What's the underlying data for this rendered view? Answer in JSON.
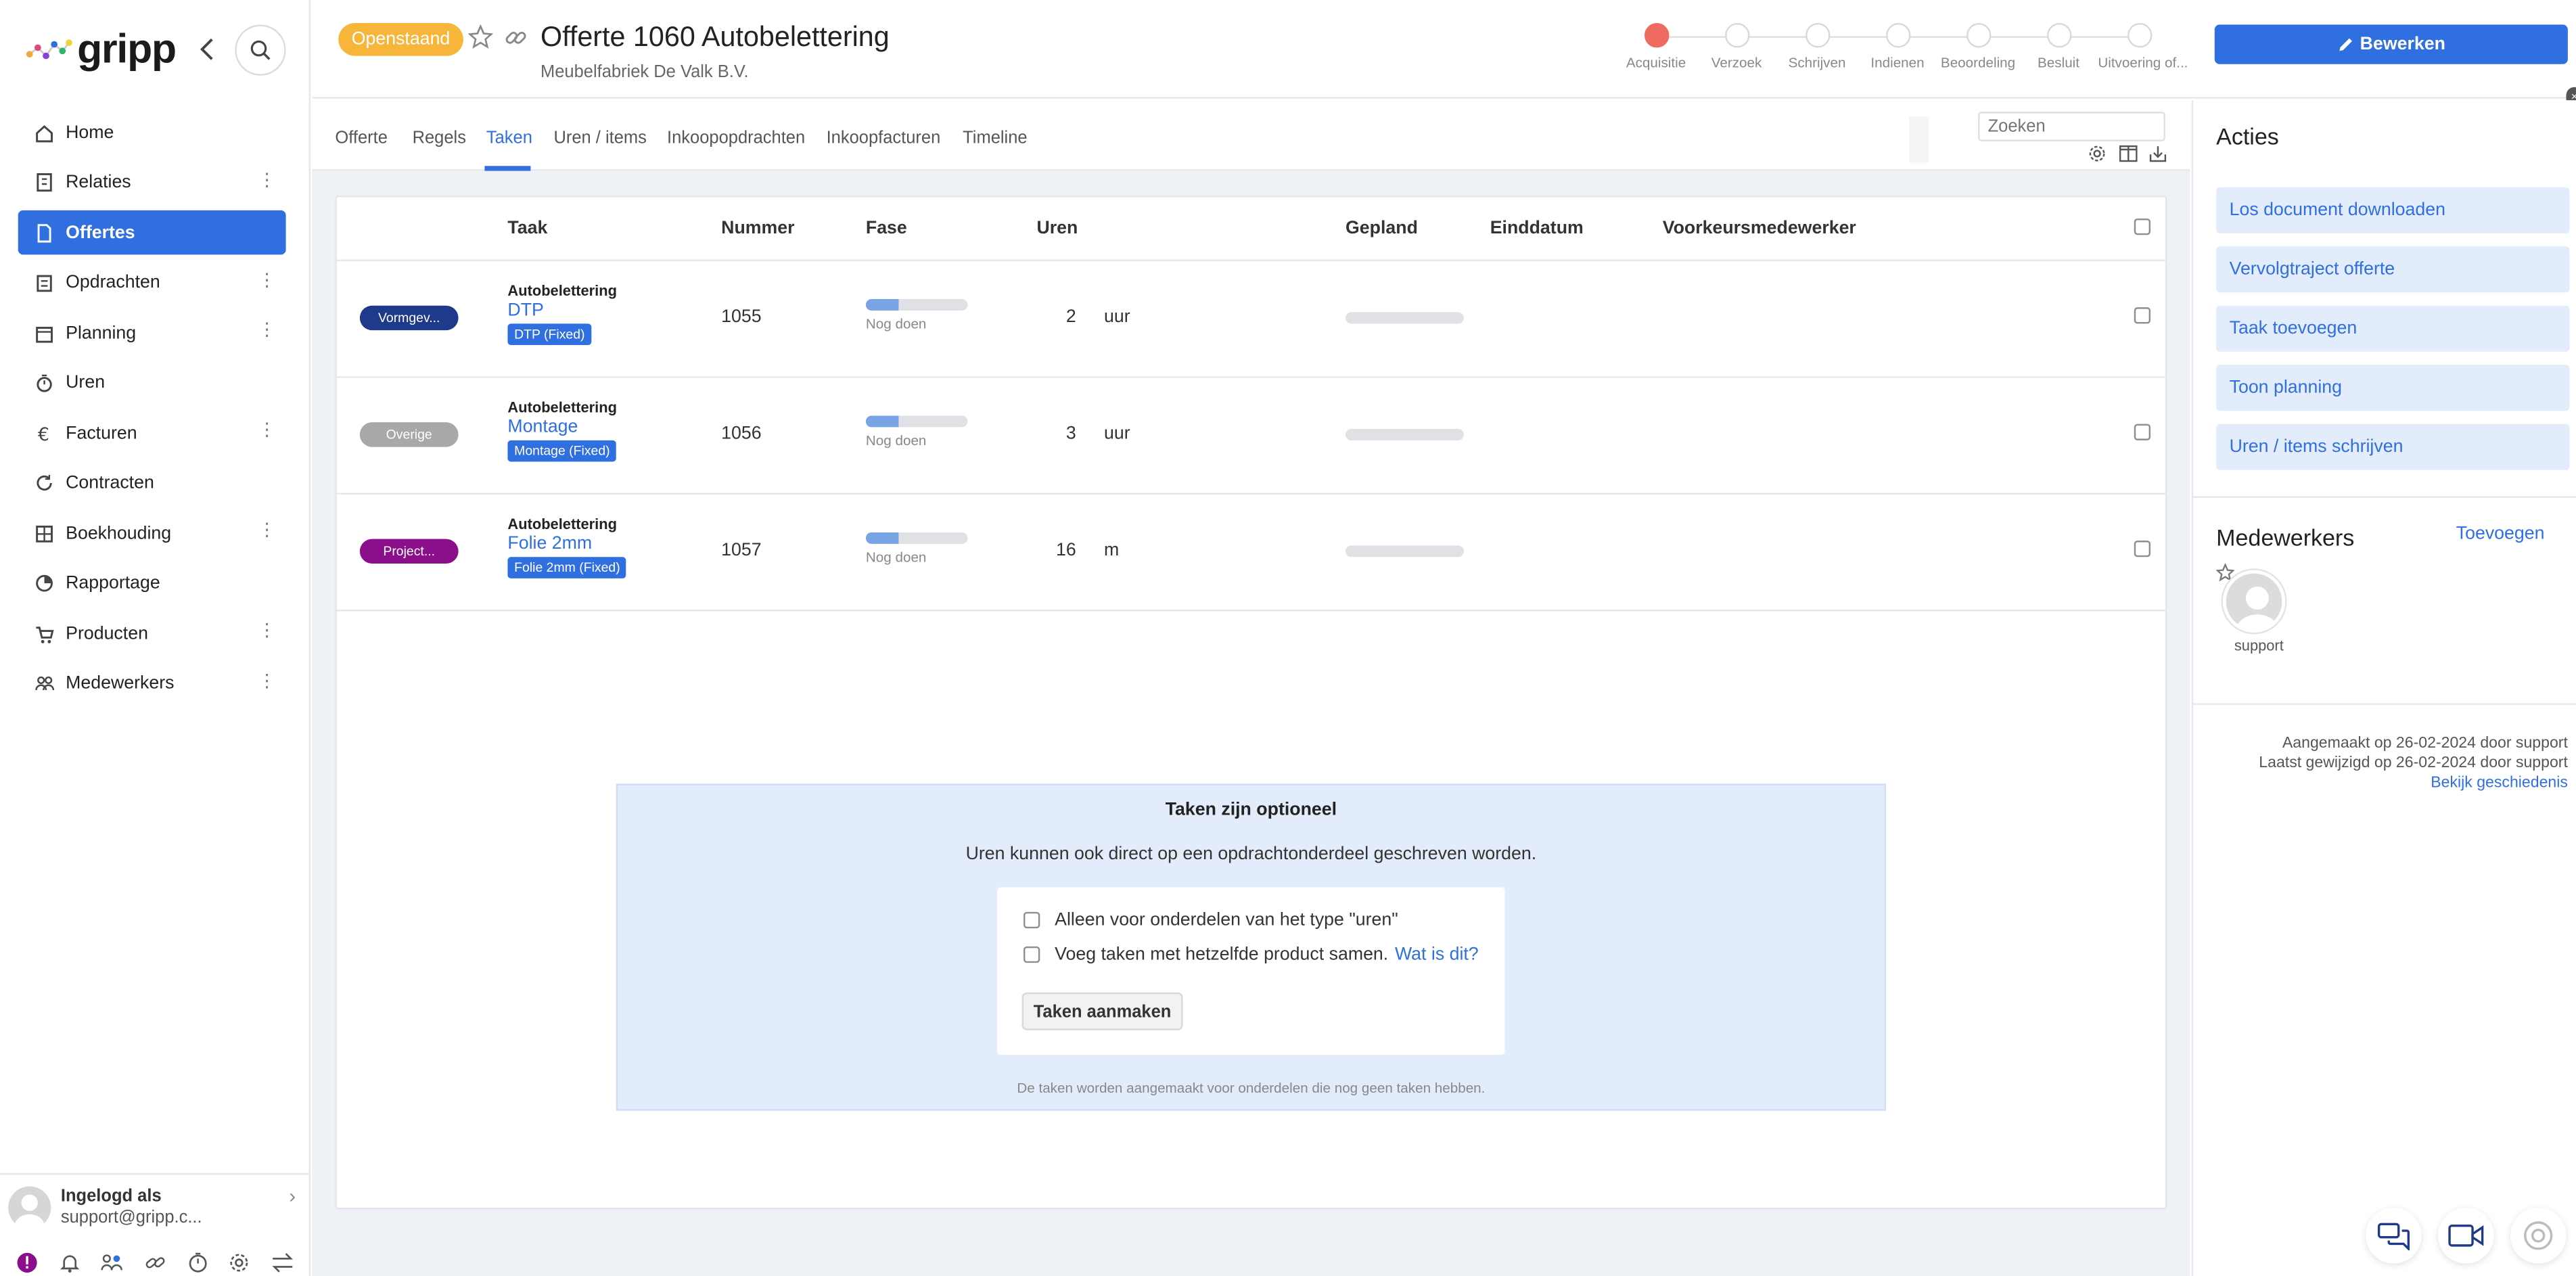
{
  "app": {
    "logo_text": "gripp",
    "brand_color": "#2f6fe0"
  },
  "sidebar": {
    "items": [
      {
        "label": "Home",
        "icon": "home-icon",
        "active": false,
        "more": false
      },
      {
        "label": "Relaties",
        "icon": "building-icon",
        "active": false,
        "more": true
      },
      {
        "label": "Offertes",
        "icon": "document-icon",
        "active": true,
        "more": false
      },
      {
        "label": "Opdrachten",
        "icon": "clipboard-icon",
        "active": false,
        "more": true
      },
      {
        "label": "Planning",
        "icon": "calendar-icon",
        "active": false,
        "more": true
      },
      {
        "label": "Uren",
        "icon": "stopwatch-icon",
        "active": false,
        "more": false
      },
      {
        "label": "Facturen",
        "icon": "euro-icon",
        "active": false,
        "more": true
      },
      {
        "label": "Contracten",
        "icon": "refresh-icon",
        "active": false,
        "more": false
      },
      {
        "label": "Boekhouding",
        "icon": "grid-icon",
        "active": false,
        "more": true
      },
      {
        "label": "Rapportage",
        "icon": "pie-chart-icon",
        "active": false,
        "more": false
      },
      {
        "label": "Producten",
        "icon": "cart-icon",
        "active": false,
        "more": true
      },
      {
        "label": "Medewerkers",
        "icon": "people-icon",
        "active": false,
        "more": true
      }
    ],
    "user": {
      "title": "Ingelogd als",
      "email": "support@gripp.c..."
    }
  },
  "header": {
    "status": "Openstaand",
    "status_color": "#f7b53a",
    "title": "Offerte 1060 Autobelettering",
    "subtitle": "Meubelfabriek De Valk B.V.",
    "steps": [
      {
        "label": "Acquisitie",
        "done": true
      },
      {
        "label": "Verzoek",
        "done": false
      },
      {
        "label": "Schrijven",
        "done": false
      },
      {
        "label": "Indienen",
        "done": false
      },
      {
        "label": "Beoordeling",
        "done": false
      },
      {
        "label": "Besluit",
        "done": false
      },
      {
        "label": "Uitvoering of...",
        "done": false
      }
    ],
    "edit_label": "Bewerken"
  },
  "tabs": [
    "Offerte",
    "Regels",
    "Taken",
    "Uren / items",
    "Inkoopopdrachten",
    "Inkoopfacturen",
    "Timeline"
  ],
  "active_tab": "Taken",
  "search_placeholder": "Zoeken",
  "table": {
    "columns": [
      "Taak",
      "Nummer",
      "Fase",
      "Uren",
      "Gepland",
      "Einddatum",
      "Voorkeursmedewerker"
    ],
    "rows": [
      {
        "category": "Vormgev...",
        "category_color": "#1f3a8a",
        "group": "Autobelettering",
        "task": "DTP",
        "product": "DTP (Fixed)",
        "number": "1055",
        "phase": "Nog doen",
        "phase_progress": 0.33,
        "hours": "2",
        "unit": "uur"
      },
      {
        "category": "Overige",
        "category_color": "#a8a8a8",
        "group": "Autobelettering",
        "task": "Montage",
        "product": "Montage (Fixed)",
        "number": "1056",
        "phase": "Nog doen",
        "phase_progress": 0.33,
        "hours": "3",
        "unit": "uur"
      },
      {
        "category": "Project...",
        "category_color": "#8b0f8b",
        "group": "Autobelettering",
        "task": "Folie 2mm",
        "product": "Folie 2mm (Fixed)",
        "number": "1057",
        "phase": "Nog doen",
        "phase_progress": 0.33,
        "hours": "16",
        "unit": "m"
      }
    ]
  },
  "info": {
    "title": "Taken zijn optioneel",
    "text": "Uren kunnen ook direct op een opdrachtonderdeel geschreven worden.",
    "option1": "Alleen voor onderdelen van het type \"uren\"",
    "option2": "Voeg taken met hetzelfde product samen.",
    "help_link": "Wat is dit?",
    "button": "Taken aanmaken",
    "footnote": "De taken worden aangemaakt voor onderdelen die nog geen taken hebben."
  },
  "panel": {
    "actions_title": "Acties",
    "actions": [
      "Los document downloaden",
      "Vervolgtraject offerte",
      "Taak toevoegen",
      "Toon planning",
      "Uren / items schrijven"
    ],
    "members_title": "Medewerkers",
    "add_label": "Toevoegen",
    "member_name": "support",
    "created": "Aangemaakt op 26-02-2024 door support",
    "modified": "Laatst gewijzigd op 26-02-2024 door support",
    "history_link": "Bekijk geschiedenis"
  }
}
